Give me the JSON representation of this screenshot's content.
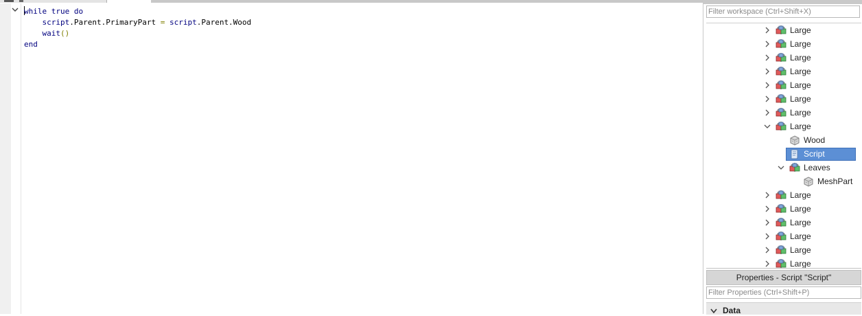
{
  "editor": {
    "lines": [
      [
        {
          "t": "while",
          "c": "kw"
        },
        {
          "t": " ",
          "c": "ident"
        },
        {
          "t": "true",
          "c": "kw"
        },
        {
          "t": " ",
          "c": "ident"
        },
        {
          "t": "do",
          "c": "kw"
        }
      ],
      [
        {
          "t": "    ",
          "c": "ident"
        },
        {
          "t": "script",
          "c": "id"
        },
        {
          "t": ".Parent.PrimaryPart ",
          "c": "ident"
        },
        {
          "t": "=",
          "c": "op"
        },
        {
          "t": " ",
          "c": "ident"
        },
        {
          "t": "script",
          "c": "id"
        },
        {
          "t": ".Parent.Wood",
          "c": "ident"
        }
      ],
      [
        {
          "t": "    ",
          "c": "ident"
        },
        {
          "t": "wait",
          "c": "fn"
        },
        {
          "t": "()",
          "c": "op"
        }
      ],
      [
        {
          "t": "end",
          "c": "kw"
        }
      ]
    ]
  },
  "explorer": {
    "filter_placeholder": "Filter workspace (Ctrl+Shift+X)",
    "items": [
      {
        "label": "Large",
        "icon": "model-icon",
        "chevron": "right",
        "depth": 0
      },
      {
        "label": "Large",
        "icon": "model-icon",
        "chevron": "right",
        "depth": 0
      },
      {
        "label": "Large",
        "icon": "model-icon",
        "chevron": "right",
        "depth": 0
      },
      {
        "label": "Large",
        "icon": "model-icon",
        "chevron": "right",
        "depth": 0
      },
      {
        "label": "Large",
        "icon": "model-icon",
        "chevron": "right",
        "depth": 0
      },
      {
        "label": "Large",
        "icon": "model-icon",
        "chevron": "right",
        "depth": 0
      },
      {
        "label": "Large",
        "icon": "model-icon",
        "chevron": "right",
        "depth": 0
      },
      {
        "label": "Large",
        "icon": "model-icon",
        "chevron": "down",
        "depth": 0
      },
      {
        "label": "Wood",
        "icon": "meshpart-icon",
        "chevron": "none",
        "depth": 1
      },
      {
        "label": "Script",
        "icon": "script-icon",
        "chevron": "none",
        "depth": 1,
        "selected": true
      },
      {
        "label": "Leaves",
        "icon": "model-icon",
        "chevron": "down",
        "depth": 1
      },
      {
        "label": "MeshPart",
        "icon": "meshpart-icon",
        "chevron": "none",
        "depth": 2
      },
      {
        "label": "Large",
        "icon": "model-icon",
        "chevron": "right",
        "depth": 0
      },
      {
        "label": "Large",
        "icon": "model-icon",
        "chevron": "right",
        "depth": 0
      },
      {
        "label": "Large",
        "icon": "model-icon",
        "chevron": "right",
        "depth": 0
      },
      {
        "label": "Large",
        "icon": "model-icon",
        "chevron": "right",
        "depth": 0
      },
      {
        "label": "Large",
        "icon": "model-icon",
        "chevron": "right",
        "depth": 0
      },
      {
        "label": "Large",
        "icon": "model-icon",
        "chevron": "right",
        "depth": 0
      }
    ]
  },
  "properties": {
    "header": "Properties - Script \"Script\"",
    "filter_placeholder": "Filter Properties (Ctrl+Shift+P)",
    "section_label": "Data"
  },
  "colors": {
    "selection": "#5c8fd5",
    "keyword": "#00007f",
    "operator": "#7f7f00"
  }
}
